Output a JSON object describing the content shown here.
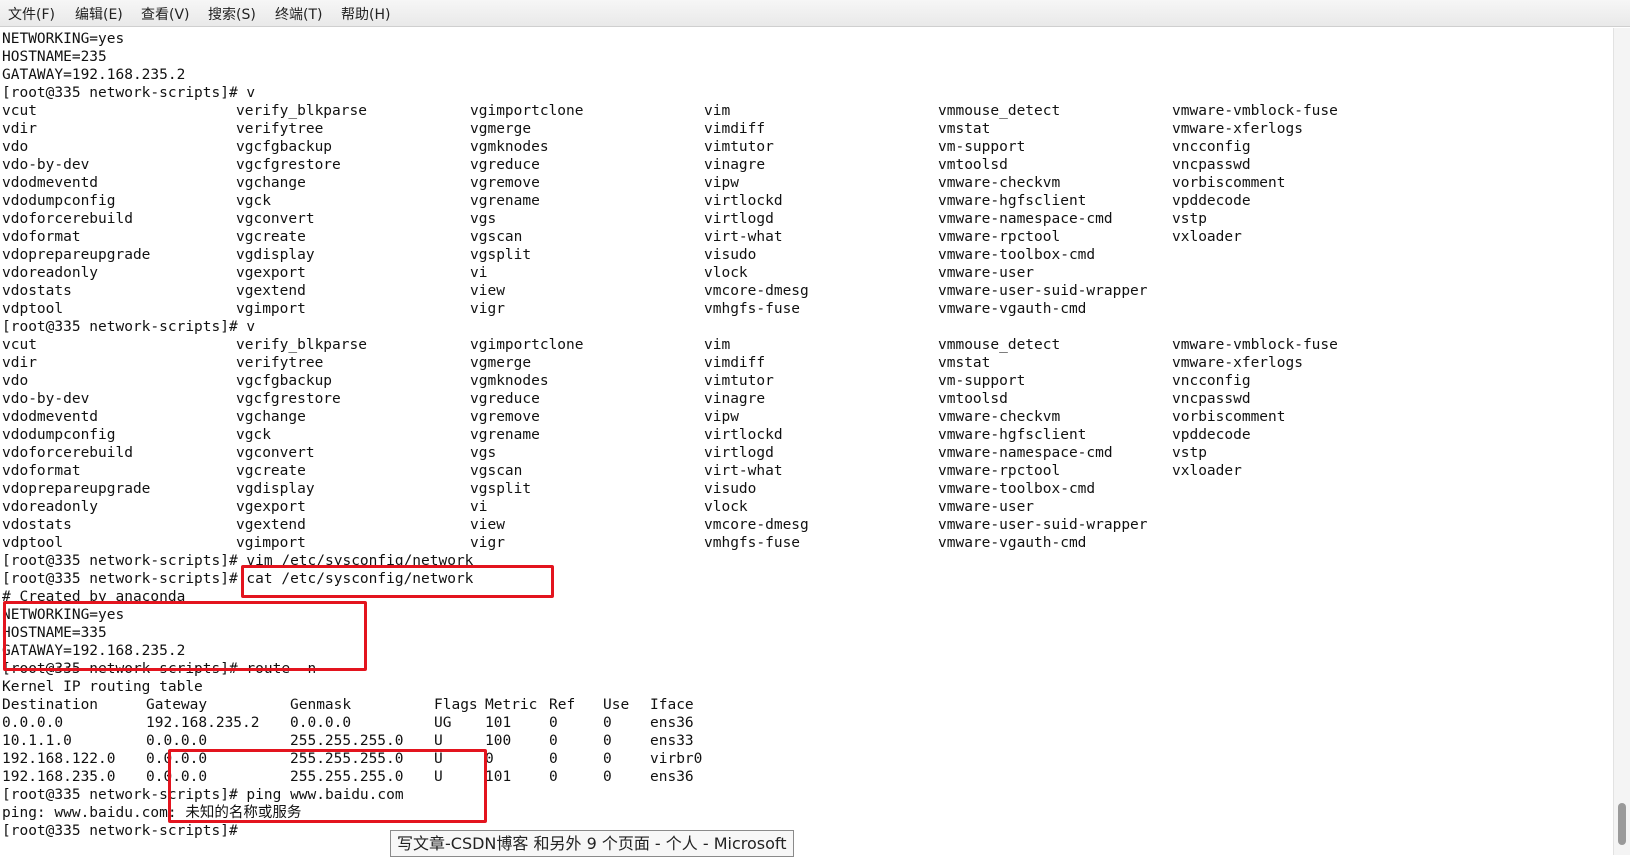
{
  "menubar": {
    "items": [
      "文件(F)",
      "编辑(E)",
      "查看(V)",
      "搜索(S)",
      "终端(T)",
      "帮助(H)"
    ]
  },
  "terminal": {
    "lines": [
      "NETWORKING=yes",
      "HOSTNAME=235",
      "GATAWAY=192.168.235.2",
      "[root@335 network-scripts]# v",
      null,
      null,
      null,
      null,
      null,
      null,
      null,
      null,
      null,
      null,
      null,
      null,
      "[root@335 network-scripts]# v",
      null,
      null,
      null,
      null,
      null,
      null,
      null,
      null,
      null,
      null,
      null,
      null,
      "[root@335 network-scripts]# vim /etc/sysconfig/network",
      "[root@335 network-scripts]# cat /etc/sysconfig/network",
      "# Created by anaconda",
      "NETWORKING=yes",
      "HOSTNAME=335",
      "GATAWAY=192.168.235.2",
      "[root@335 network-scripts]# route -n",
      "Kernel IP routing table",
      null,
      null,
      null,
      null,
      null,
      "[root@335 network-scripts]# ping www.baidu.com",
      "ping: www.baidu.com: 未知的名称或服务",
      "[root@335 network-scripts]#"
    ],
    "completions": [
      [
        "vcut",
        "verify_blkparse",
        "vgimportclone",
        "vim",
        "vmmouse_detect",
        "vmware-vmblock-fuse"
      ],
      [
        "vdir",
        "verifytree",
        "vgmerge",
        "vimdiff",
        "vmstat",
        "vmware-xferlogs"
      ],
      [
        "vdo",
        "vgcfgbackup",
        "vgmknodes",
        "vimtutor",
        "vm-support",
        "vncconfig"
      ],
      [
        "vdo-by-dev",
        "vgcfgrestore",
        "vgreduce",
        "vinagre",
        "vmtoolsd",
        "vncpasswd"
      ],
      [
        "vdodmeventd",
        "vgchange",
        "vgremove",
        "vipw",
        "vmware-checkvm",
        "vorbiscomment"
      ],
      [
        "vdodumpconfig",
        "vgck",
        "vgrename",
        "virtlockd",
        "vmware-hgfsclient",
        "vpddecode"
      ],
      [
        "vdoforcerebuild",
        "vgconvert",
        "vgs",
        "virtlogd",
        "vmware-namespace-cmd",
        "vstp"
      ],
      [
        "vdoformat",
        "vgcreate",
        "vgscan",
        "virt-what",
        "vmware-rpctool",
        "vxloader"
      ],
      [
        "vdoprepareupgrade",
        "vgdisplay",
        "vgsplit",
        "visudo",
        "vmware-toolbox-cmd",
        ""
      ],
      [
        "vdoreadonly",
        "vgexport",
        "vi",
        "vlock",
        "vmware-user",
        ""
      ],
      [
        "vdostats",
        "vgextend",
        "view",
        "vmcore-dmesg",
        "vmware-user-suid-wrapper",
        ""
      ],
      [
        "vdptool",
        "vgimport",
        "vigr",
        "vmhgfs-fuse",
        "vmware-vgauth-cmd",
        ""
      ]
    ],
    "route_table": [
      [
        "Destination",
        "Gateway",
        "Genmask",
        "Flags",
        "Metric",
        "Ref",
        "Use",
        "Iface"
      ],
      [
        "0.0.0.0",
        "192.168.235.2",
        "0.0.0.0",
        "UG",
        "101",
        "0",
        "0",
        "ens36"
      ],
      [
        "10.1.1.0",
        "0.0.0.0",
        "255.255.255.0",
        "U",
        "100",
        "0",
        "0",
        "ens33"
      ],
      [
        "192.168.122.0",
        "0.0.0.0",
        "255.255.255.0",
        "U",
        "0",
        "0",
        "0",
        "virbr0"
      ],
      [
        "192.168.235.0",
        "0.0.0.0",
        "255.255.255.0",
        "U",
        "101",
        "0",
        "0",
        "ens36"
      ]
    ]
  },
  "taskbar_tooltip": "写文章-CSDN博客 和另外 9 个页面 - 个人 - Microsoft",
  "colors": {
    "highlight": "#e3141e",
    "text": "#111111",
    "background": "#ffffff"
  }
}
